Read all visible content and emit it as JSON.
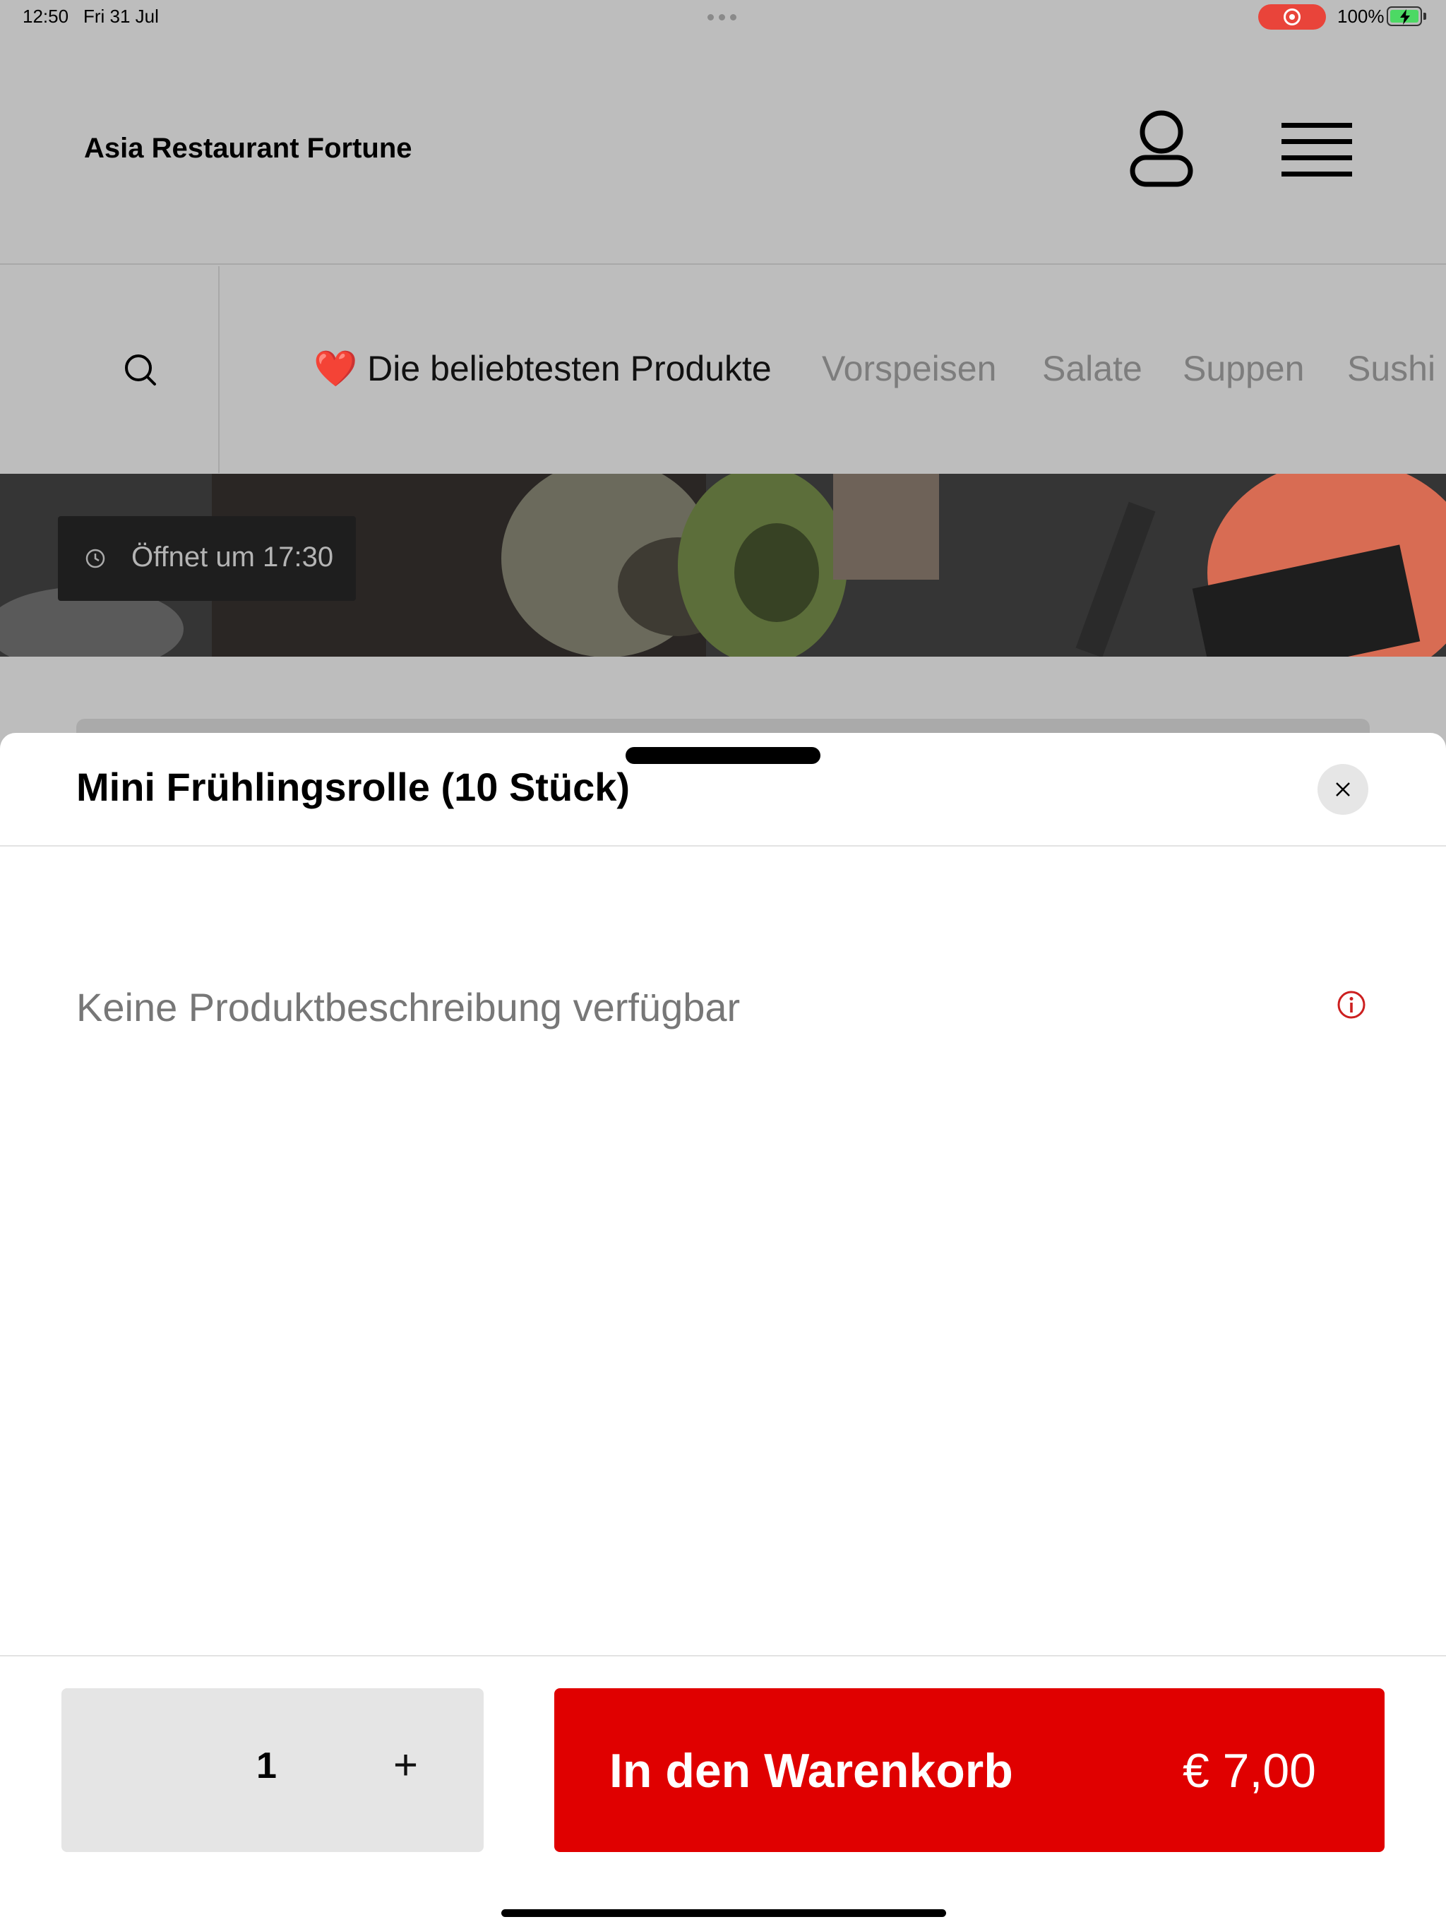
{
  "status_bar": {
    "time": "12:50",
    "date": "Fri 31 Jul",
    "battery": "100%"
  },
  "header": {
    "title": "Asia Restaurant Fortune",
    "icons": [
      "user-icon",
      "menu-icon"
    ]
  },
  "categories": [
    {
      "label": "❤️ Die beliebtesten Produkte",
      "active": true
    },
    {
      "label": "Vorspeisen",
      "active": false
    },
    {
      "label": "Salate",
      "active": false
    },
    {
      "label": "Suppen",
      "active": false
    },
    {
      "label": "Sushi",
      "active": false
    }
  ],
  "hero": {
    "opening_text": "Öffnet um 17:30"
  },
  "product_sheet": {
    "title": "Mini Frühlingsrolle (10 Stück)",
    "description": "Keine Produktbeschreibung verfügbar",
    "quantity": "1",
    "plus": "+",
    "add_to_cart_label": "In den Warenkorb",
    "price": "€ 7,00"
  },
  "colors": {
    "accent": "#e00000",
    "info": "#cc1f1f",
    "overlay": "#bdbdbd"
  }
}
